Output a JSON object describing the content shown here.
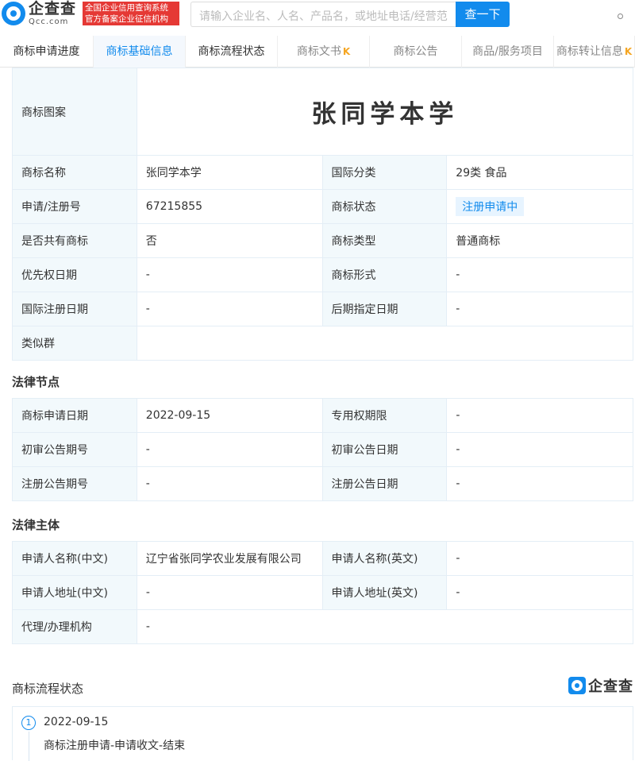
{
  "header": {
    "logo_cn": "企查查",
    "logo_en": "Qcc.com",
    "badge_line1": "全国企业信用查询系统",
    "badge_line2": "官方备案企业征信机构",
    "search_placeholder": "请输入企业名、人名、产品名，或地址电话/经营范",
    "search_button": "查一下"
  },
  "tabs": [
    {
      "label": "商标申请进度",
      "active": false,
      "vip": false
    },
    {
      "label": "商标基础信息",
      "active": true,
      "vip": false
    },
    {
      "label": "商标流程状态",
      "active": false,
      "vip": false
    },
    {
      "label": "商标文书",
      "active": false,
      "vip": true
    },
    {
      "label": "商标公告",
      "active": false,
      "vip": false
    },
    {
      "label": "商品/服务项目",
      "active": false,
      "vip": false
    },
    {
      "label": "商标转让信息",
      "active": false,
      "vip": true
    }
  ],
  "basic": {
    "image_label": "商标图案",
    "image_text": "张同学本学",
    "rows": [
      {
        "l1": "商标名称",
        "v1": "张同学本学",
        "l2": "国际分类",
        "v2": "29类 食品"
      },
      {
        "l1": "申请/注册号",
        "v1": "67215855",
        "l2": "商标状态",
        "v2": "注册申请中"
      },
      {
        "l1": "是否共有商标",
        "v1": "否",
        "l2": "商标类型",
        "v2": "普通商标"
      },
      {
        "l1": "优先权日期",
        "v1": "-",
        "l2": "商标形式",
        "v2": "-"
      },
      {
        "l1": "国际注册日期",
        "v1": "-",
        "l2": "后期指定日期",
        "v2": "-"
      }
    ],
    "similar_label": "类似群",
    "similar_value": ""
  },
  "legal_nodes": {
    "title": "法律节点",
    "rows": [
      {
        "l1": "商标申请日期",
        "v1": "2022-09-15",
        "l2": "专用权期限",
        "v2": "-"
      },
      {
        "l1": "初审公告期号",
        "v1": "-",
        "l2": "初审公告日期",
        "v2": "-"
      },
      {
        "l1": "注册公告期号",
        "v1": "-",
        "l2": "注册公告日期",
        "v2": "-"
      }
    ]
  },
  "legal_subject": {
    "title": "法律主体",
    "rows": [
      {
        "l1": "申请人名称(中文)",
        "v1": "辽宁省张同学农业发展有限公司",
        "l2": "申请人名称(英文)",
        "v2": "-"
      },
      {
        "l1": "申请人地址(中文)",
        "v1": "-",
        "l2": "申请人地址(英文)",
        "v2": "-"
      }
    ],
    "agent_label": "代理/办理机构",
    "agent_value": "-"
  },
  "flow": {
    "title": "商标流程状态",
    "brand": "企查查",
    "items": [
      {
        "num": "1",
        "date": "2022-09-15",
        "desc": "商标注册申请-申请收文-结束"
      }
    ]
  },
  "colors": {
    "accent": "#128bed",
    "label_bg": "#f2f9fc",
    "badge_red": "#e53935"
  }
}
